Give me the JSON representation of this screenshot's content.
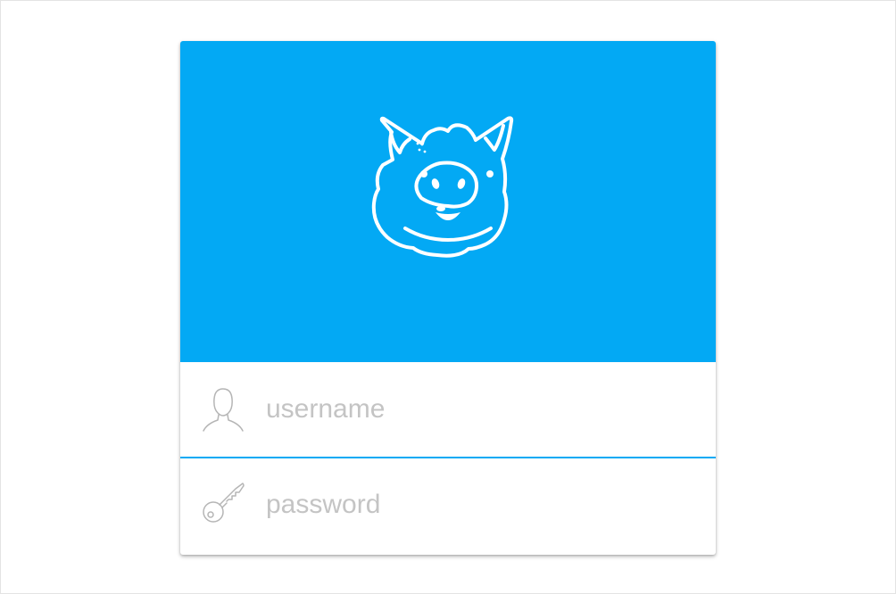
{
  "login": {
    "username": {
      "value": "",
      "placeholder": "username",
      "icon": "user-icon"
    },
    "password": {
      "value": "",
      "placeholder": "password",
      "icon": "key-icon"
    },
    "logo": "pig-logo-icon"
  },
  "colors": {
    "accent": "#03a9f4",
    "placeholder": "#c4c4c4",
    "icon_stroke": "#b5b5b5",
    "background": "#ffffff"
  }
}
